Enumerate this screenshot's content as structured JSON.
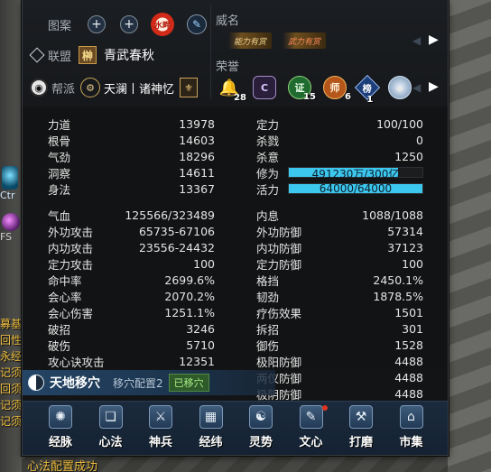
{
  "side": {
    "ctr_label": "Ctr",
    "fs_label": "FS",
    "chat_lines": [
      "募基",
      "回性",
      "永经",
      "记须",
      "回须",
      "记须",
      "记须"
    ],
    "bottom_chat": "心法配置成功"
  },
  "top": {
    "tuan_label": "图案",
    "seal_text": "水畔",
    "alliance_label": "联盟",
    "alliance_tag": "榊",
    "alliance_name": "青武春秋",
    "gang_label": "帮派",
    "gang_name": "天澜丨诸神忆",
    "fame_label": "威名",
    "fame_titles": [
      "能力有赏",
      "武力有赏"
    ],
    "honor_label": "荣誉",
    "honors": [
      {
        "name": "bell-honor-icon",
        "glyph": "🔔",
        "count": "28"
      },
      {
        "name": "c-honor-icon",
        "glyph": "C",
        "count": ""
      },
      {
        "name": "zheng-honor-icon",
        "glyph": "证",
        "count": "15"
      },
      {
        "name": "shi-honor-icon",
        "glyph": "师",
        "count": "6"
      },
      {
        "name": "bang-honor-icon",
        "glyph": "榜",
        "count": "1"
      },
      {
        "name": "gem-honor-icon",
        "glyph": "◆",
        "count": ""
      }
    ]
  },
  "stats": {
    "left_block1": [
      {
        "name": "力道",
        "value": "13978"
      },
      {
        "name": "根骨",
        "value": "14603"
      },
      {
        "name": "气劲",
        "value": "18296"
      },
      {
        "name": "洞察",
        "value": "14611"
      },
      {
        "name": "身法",
        "value": "13367"
      }
    ],
    "right_block1": [
      {
        "name": "定力",
        "value": "100/100"
      },
      {
        "name": "杀戮",
        "value": "0"
      },
      {
        "name": "杀意",
        "value": "1250"
      }
    ],
    "xiuwei": {
      "name": "修为",
      "text": "491230万/300亿",
      "fill": 0.82
    },
    "huoli": {
      "name": "活力",
      "text": "64000/64000",
      "fill": 1.0
    },
    "left_block2": [
      {
        "name": "气血",
        "value": "125566/323489"
      },
      {
        "name": "外功攻击",
        "value": "65735-67106"
      },
      {
        "name": "内功攻击",
        "value": "23556-24432"
      },
      {
        "name": "定力攻击",
        "value": "100"
      },
      {
        "name": "命中率",
        "value": "2699.6%"
      },
      {
        "name": "会心率",
        "value": "2070.2%"
      },
      {
        "name": "会心伤害",
        "value": "1251.1%"
      },
      {
        "name": "破招",
        "value": "3246"
      },
      {
        "name": "破伤",
        "value": "5710"
      },
      {
        "name": "攻心诀攻击",
        "value": "12351"
      }
    ],
    "right_block2": [
      {
        "name": "内息",
        "value": "1088/1088"
      },
      {
        "name": "外功防御",
        "value": "57314"
      },
      {
        "name": "内功防御",
        "value": "37123"
      },
      {
        "name": "定力防御",
        "value": "100"
      },
      {
        "name": "格挡",
        "value": "2450.1%"
      },
      {
        "name": "韧劲",
        "value": "1878.5%"
      },
      {
        "name": "疗伤效果",
        "value": "1501"
      },
      {
        "name": "拆招",
        "value": "301"
      },
      {
        "name": "御伤",
        "value": "1528"
      },
      {
        "name": "极阳防御",
        "value": "4488"
      },
      {
        "name": "两仪防御",
        "value": "4488"
      },
      {
        "name": "极阴防御",
        "value": "4488"
      }
    ]
  },
  "acupoint": {
    "title": "天地移穴",
    "config": "移穴配置2",
    "status": "已移穴"
  },
  "toolbar": {
    "buttons": [
      {
        "name": "jingmai",
        "label": "经脉",
        "glyph": "✺"
      },
      {
        "name": "xinfa",
        "label": "心法",
        "glyph": "❏"
      },
      {
        "name": "shenbing",
        "label": "神兵",
        "glyph": "⚔"
      },
      {
        "name": "jingwei",
        "label": "经纬",
        "glyph": "▦"
      },
      {
        "name": "lingshi",
        "label": "灵势",
        "glyph": "☯"
      },
      {
        "name": "wenxin",
        "label": "文心",
        "glyph": "✎"
      },
      {
        "name": "damo",
        "label": "打磨",
        "glyph": "⚒"
      },
      {
        "name": "shiji",
        "label": "市集",
        "glyph": "⌂"
      }
    ]
  },
  "colors": {
    "bar_fill": "#3cc8ee",
    "panel_bg": "#131415",
    "toolbar_bg": "#1b2a3c",
    "chat_gold": "#f0c040"
  }
}
